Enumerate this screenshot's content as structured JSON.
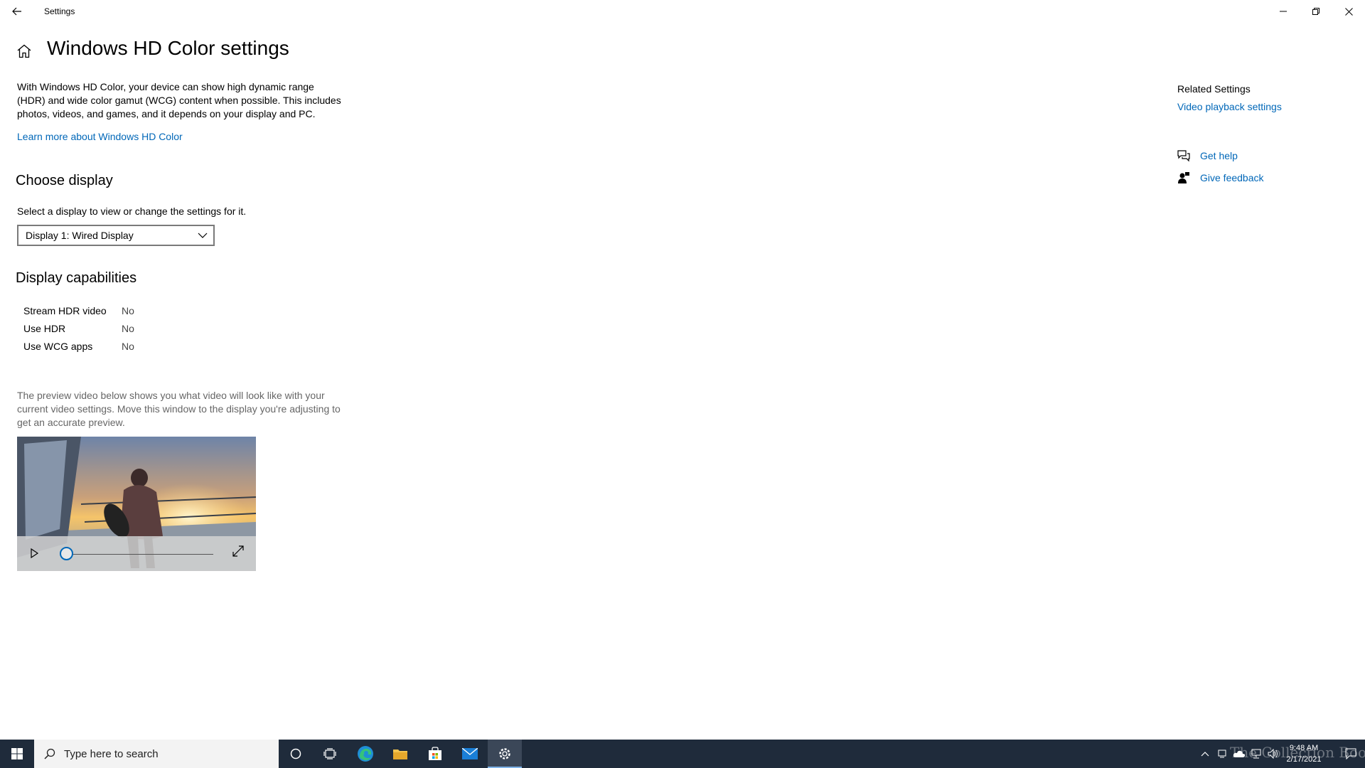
{
  "titlebar": {
    "app_title": "Settings",
    "back_icon": "back-arrow-icon",
    "controls": [
      "minimize-icon",
      "restore-icon",
      "close-icon"
    ]
  },
  "header": {
    "home_icon": "home-icon",
    "title": "Windows HD Color settings"
  },
  "intro": {
    "description": "With Windows HD Color, your device can show high dynamic range (HDR) and wide color gamut (WCG) content when possible. This includes photos, videos, and games, and it depends on your display and PC.",
    "learn_more": "Learn more about Windows HD Color"
  },
  "choose_display": {
    "title": "Choose display",
    "label": "Select a display to view or change the settings for it.",
    "selected": "Display 1: Wired Display"
  },
  "capabilities": {
    "title": "Display capabilities",
    "rows": [
      {
        "name": "Stream HDR video",
        "value": "No"
      },
      {
        "name": "Use HDR",
        "value": "No"
      },
      {
        "name": "Use WCG apps",
        "value": "No"
      }
    ]
  },
  "preview": {
    "note": "The preview video below shows you what video will look like with your current video settings. Move this window to the display you're adjusting to get an accurate preview.",
    "playback_progress": 0
  },
  "related": {
    "title": "Related Settings",
    "video_playback": "Video playback settings",
    "get_help": "Get help",
    "give_feedback": "Give feedback"
  },
  "taskbar": {
    "search_placeholder": "Type here to search",
    "time": "9:48 AM",
    "date": "2/17/2021",
    "watermark": "The Collection Book"
  },
  "colors": {
    "accent": "#0067b8",
    "taskbar": "#1f2b3b"
  }
}
